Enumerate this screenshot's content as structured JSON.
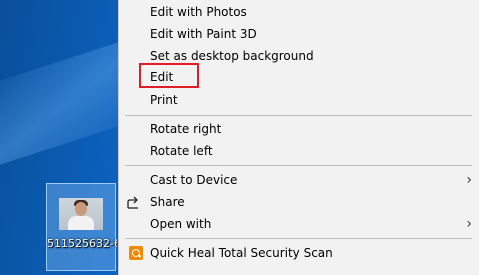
{
  "desktop": {
    "icon": {
      "label": "511525632-6’–2x612",
      "image_name": "person-photo-thumbnail"
    },
    "background_color": "#0b63c0"
  },
  "context_menu": {
    "items": [
      {
        "label": "Edit with Photos"
      },
      {
        "label": "Edit with Paint 3D"
      },
      {
        "label": "Set as desktop background"
      },
      {
        "label": "Edit",
        "highlighted": true,
        "highlight_color": "#e31d25"
      },
      {
        "label": "Print"
      },
      {
        "label": "Rotate right"
      },
      {
        "label": "Rotate left"
      },
      {
        "label": "Cast to Device",
        "has_submenu": true
      },
      {
        "label": "Share",
        "icon": "share-icon"
      },
      {
        "label": "Open with",
        "has_submenu": true
      },
      {
        "label": "Quick Heal Total Security Scan",
        "icon": "quick-heal-icon",
        "icon_color": "#f08a00"
      }
    ],
    "submenu_arrow": "›"
  }
}
